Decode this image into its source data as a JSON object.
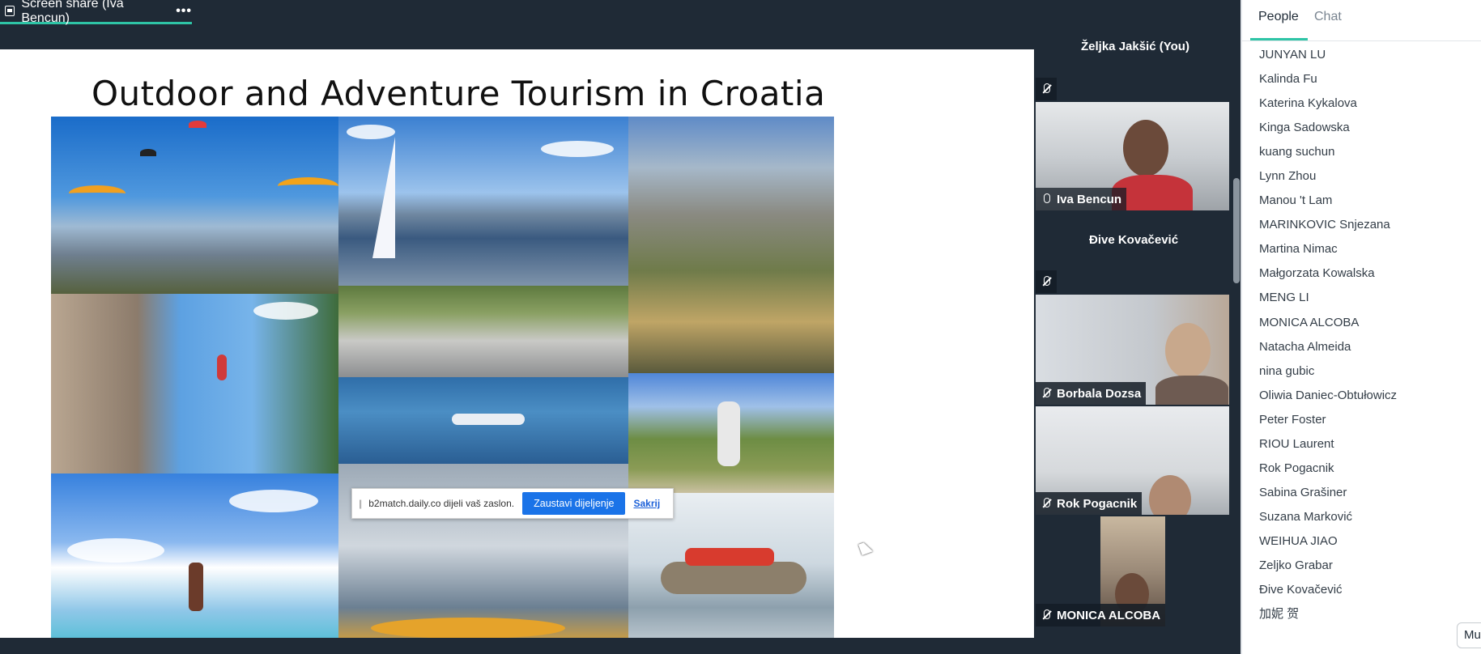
{
  "share": {
    "tab_label": "Screen share (Iva Bencun)",
    "menu_dots": "•••",
    "slide_title": "Outdoor and Adventure Tourism in Croatia",
    "notice": {
      "message": "b2match.daily.co dijeli vaš zaslon.",
      "stop_label": "Zaustavi dijeljenje",
      "hide_label": "Sakrij"
    }
  },
  "tiles": [
    {
      "name": "Željka Jakšić (You)",
      "muted": true,
      "video": false
    },
    {
      "name": "Iva Bencun",
      "muted": false,
      "video": true,
      "active": true
    },
    {
      "name": "Đive Kovačević",
      "muted": true,
      "video": false
    },
    {
      "name": "Borbala Dozsa",
      "muted": true,
      "video": true
    },
    {
      "name": "Rok Pogacnik",
      "muted": true,
      "video": true
    },
    {
      "name": "MONICA ALCOBA",
      "muted": true,
      "video": true
    }
  ],
  "panel": {
    "tab_people": "People",
    "tab_chat": "Chat",
    "people": [
      "JUNYAN LU",
      "Kalinda Fu",
      "Katerina Kykalova",
      "Kinga Sadowska",
      "kuang suchun",
      "Lynn Zhou",
      "Manou 't Lam",
      "MARINKOVIC Snjezana",
      "Martina Nimac",
      "Małgorzata Kowalska",
      "MENG LI",
      "MONICA ALCOBA",
      "Natacha Almeida",
      "nina gubic",
      "Oliwia Daniec-Obtułowicz",
      "Peter Foster",
      "RIOU Laurent",
      "Rok Pogacnik",
      "Sabina Grašiner",
      "Suzana Marković",
      "WEIHUA JIAO",
      "Zeljko Grabar",
      "Đive Kovačević",
      "加妮 贺"
    ],
    "mute_button": "Mu"
  },
  "colors": {
    "background": "#1f2a36",
    "accent": "#2ec4a6",
    "active_speaker": "#f5d211",
    "stop_button": "#1a73e8"
  }
}
